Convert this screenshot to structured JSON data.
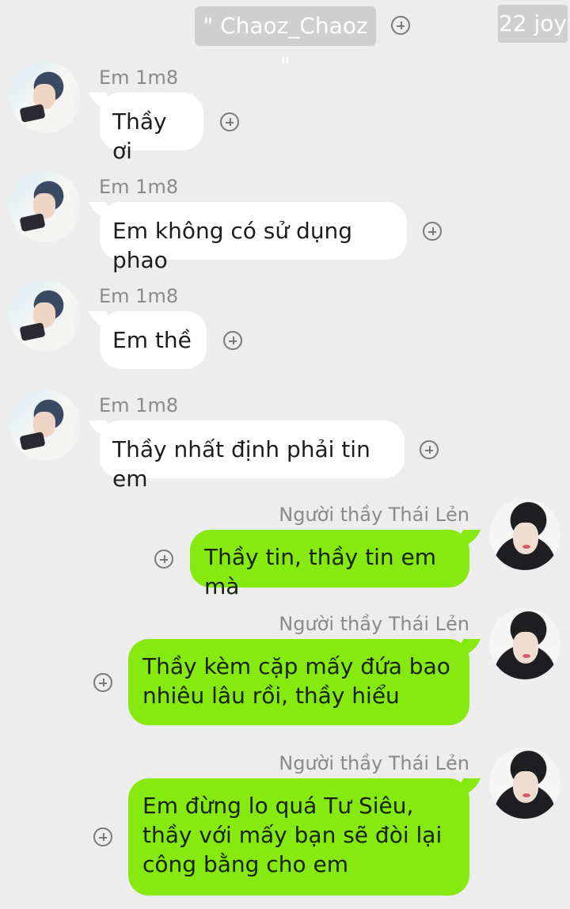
{
  "header": {
    "channel_name": "\" Chaoz_Chaoz \"",
    "counter": "22 joy"
  },
  "messages": [
    {
      "side": "left",
      "sender": "Em 1m8",
      "text": "Thầy ơi"
    },
    {
      "side": "left",
      "sender": "Em 1m8",
      "text": "Em không có sử dụng phao"
    },
    {
      "side": "left",
      "sender": "Em 1m8",
      "text": "Em thề"
    },
    {
      "side": "left",
      "sender": "Em 1m8",
      "text": "Thầy nhất định phải tin em"
    },
    {
      "side": "right",
      "sender": "Người thầy Thái Lẻn",
      "text": "Thầy tin, thầy tin em mà"
    },
    {
      "side": "right",
      "sender": "Người thầy Thái Lẻn",
      "text": "Thầy kèm cặp mấy đứa bao nhiêu lâu rồi, thầy hiểu"
    },
    {
      "side": "right",
      "sender": "Người thầy Thái Lẻn",
      "text": "Em đừng lo quá Tư Siêu, thầy với mấy bạn sẽ đòi lại công bằng cho em"
    }
  ],
  "colors": {
    "background": "#ededed",
    "outgoing_bubble": "#86e90f",
    "incoming_bubble": "#ffffff",
    "chip": "#cfcfcf"
  },
  "icons": {
    "add": "plus-circle-icon",
    "avatar_left": "avatar-em-1m8",
    "avatar_right": "avatar-thai-len"
  }
}
